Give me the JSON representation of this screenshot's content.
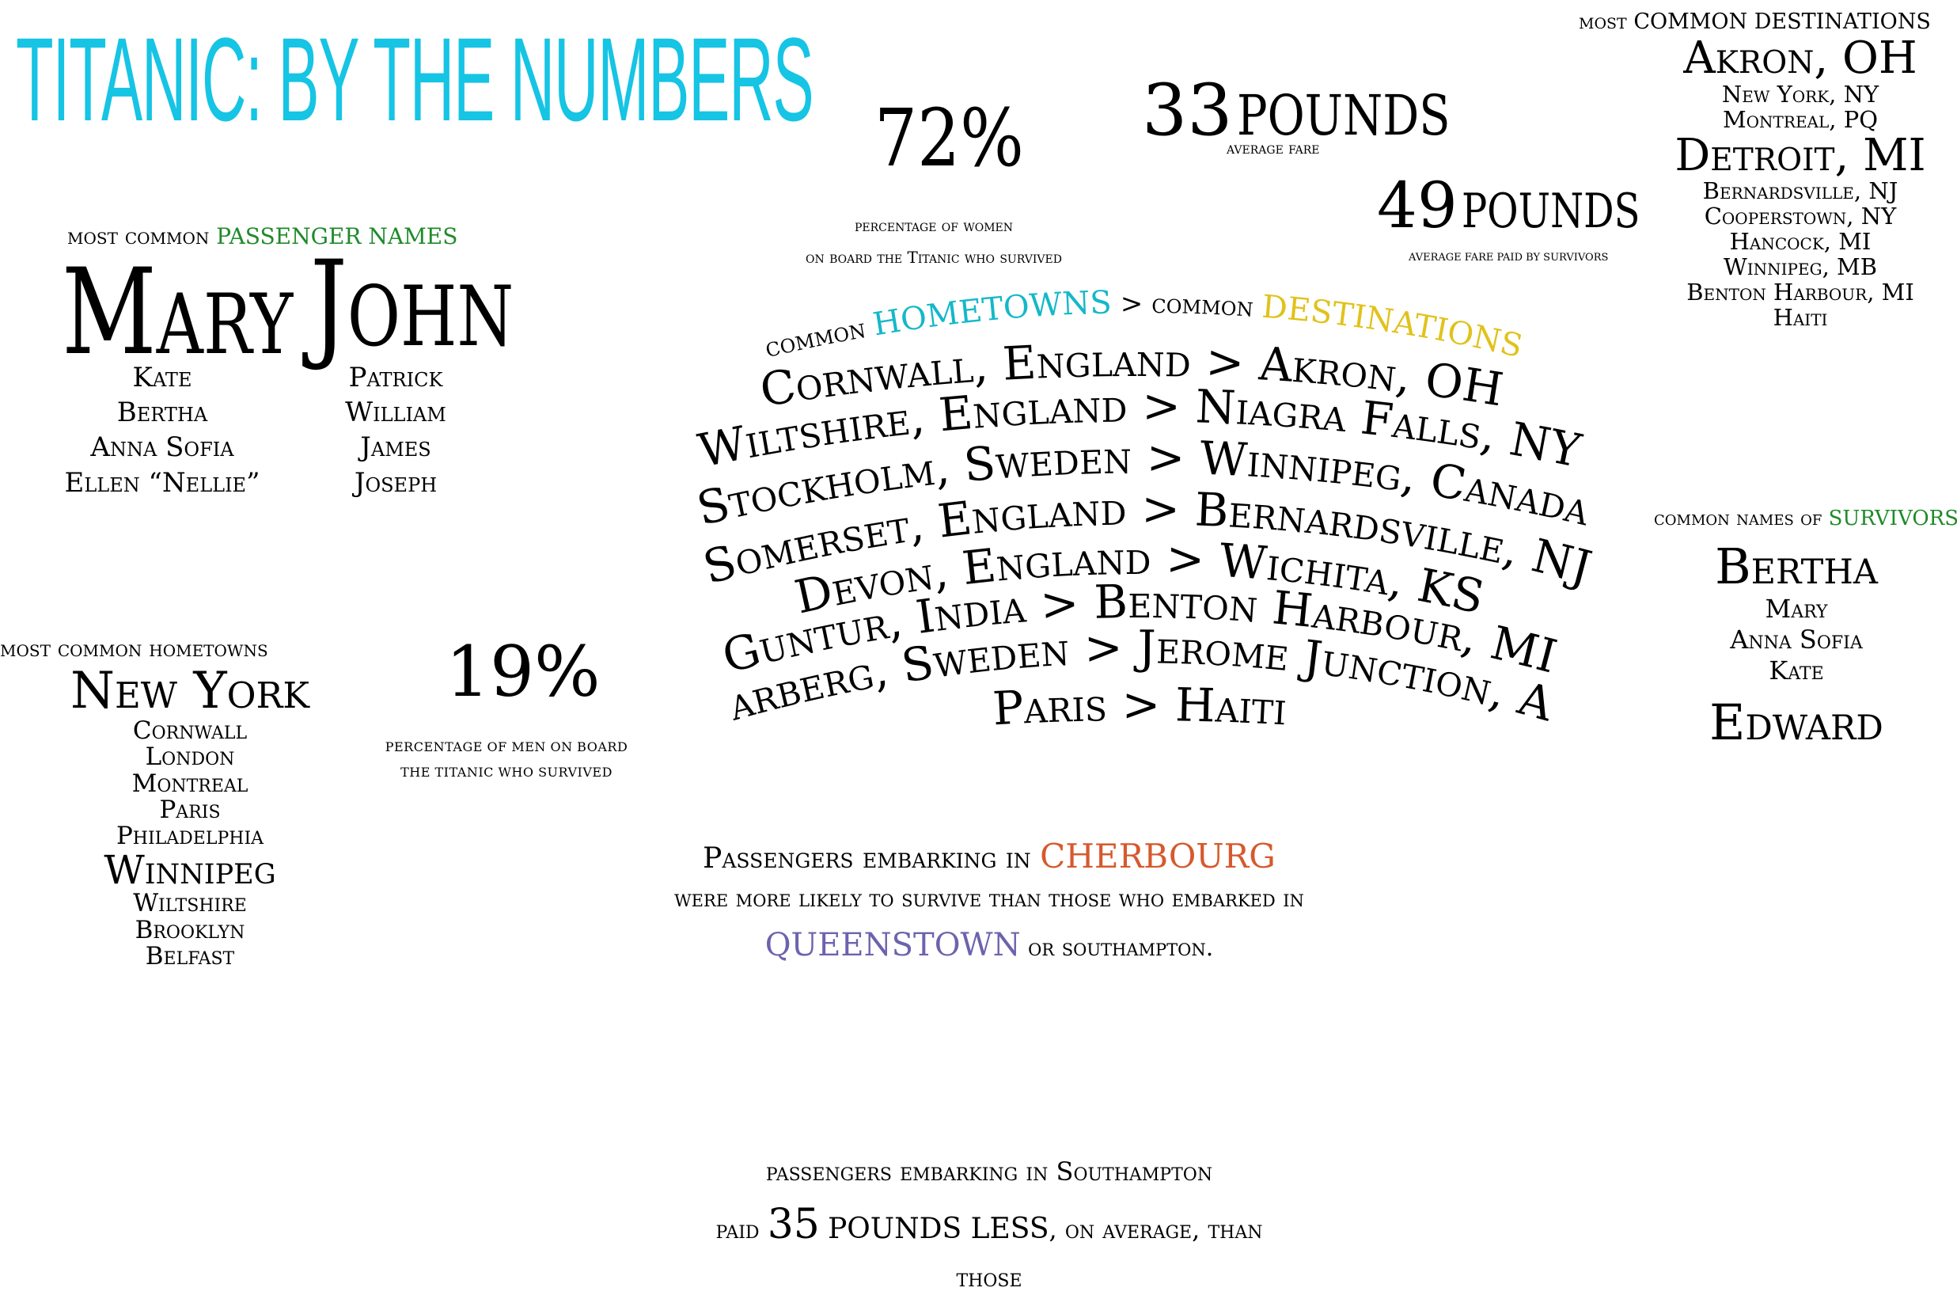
{
  "title": "Titanic: by the numbers",
  "stats": {
    "women_pct": "72%",
    "women_line1": "percentage of women",
    "women_line2": "on board the Titanic who survived",
    "avg_fare_value": "33",
    "avg_fare_unit": "POUNDS",
    "avg_fare_label": "average fare",
    "survivor_fare_value": "49",
    "survivor_fare_unit": "POUNDS",
    "survivor_fare_label": "average fare paid by survivors",
    "men_pct": "19%",
    "men_line1": "percentage of men on board",
    "men_line2": "the Titanic who survived"
  },
  "names": {
    "heading_prefix": "most common",
    "heading_highlight": "PASSENGER NAMES",
    "female_top": "Mary",
    "female_others": [
      "Kate",
      "Bertha",
      "Anna Sofia",
      "Ellen “Nellie”"
    ],
    "male_top": "John",
    "male_others": [
      "Patrick",
      "William",
      "James",
      "Joseph"
    ]
  },
  "hometowns": {
    "heading": "most common hometowns",
    "top": "New York",
    "group1": [
      "Cornwall",
      "London",
      "Montreal",
      "Paris",
      "Philadelphia"
    ],
    "second": "Winnipeg",
    "group2": [
      "Wiltshire",
      "Brooklyn",
      "Belfast"
    ]
  },
  "destinations": {
    "heading_prefix": "most",
    "heading_main": "COMMON DESTINATIONS",
    "top": "Akron, OH",
    "group1": [
      "New York, NY",
      "Montreal, PQ"
    ],
    "second": "Detroit, MI",
    "group2": [
      "Bernardsville, NJ",
      "Cooperstown, NY",
      "Hancock, MI",
      "Winnipeg, MB",
      "Benton Harbour, MI",
      "Haiti"
    ]
  },
  "survivors": {
    "heading_prefix": "common names of",
    "heading_highlight": "SURVIVORS",
    "female_top": "Bertha",
    "female_others": [
      "Mary",
      "Anna Sofia",
      "Kate"
    ],
    "male_top": "Edward"
  },
  "routes": {
    "heading_common1": "common",
    "heading_hometowns": "HOMETOWNS",
    "heading_sep": ">",
    "heading_common2": "common",
    "heading_destinations": "DESTINATIONS",
    "lines": [
      "Cornwall, England  > Akron, OH",
      "Wiltshire, England > Niagra Falls, NY",
      "Stockholm, Sweden > Winnipeg, Canada",
      "Somerset, England > Bernardsville, NJ",
      "Devon, England > Wichita, KS",
      "Guntur, India > Benton Harbour, MI",
      "Karberg, Sweden >  Jerome Junction, AZ",
      "Paris > Haiti"
    ]
  },
  "embarkation": {
    "line1_prefix": "Passengers embarking in",
    "cherbourg": "CHERBOURG",
    "line2": "were more likely to survive than those who embarked in",
    "queenstown": "QUEENSTOWN",
    "line3_suffix": "or southampton.",
    "fare_line1": "passengers embarking in Southampton",
    "fare_prefix": "paid",
    "fare_num": "35",
    "fare_mid": "POUNDS LESS",
    "fare_suffix": ", on average, than",
    "fare_line3": "those"
  },
  "colors": {
    "title": "#16c4e4",
    "green": "#1f8a2a",
    "cyan": "#14b8c9",
    "yellow": "#e1c21b",
    "orange": "#d6592d",
    "purple": "#6c63ae"
  }
}
